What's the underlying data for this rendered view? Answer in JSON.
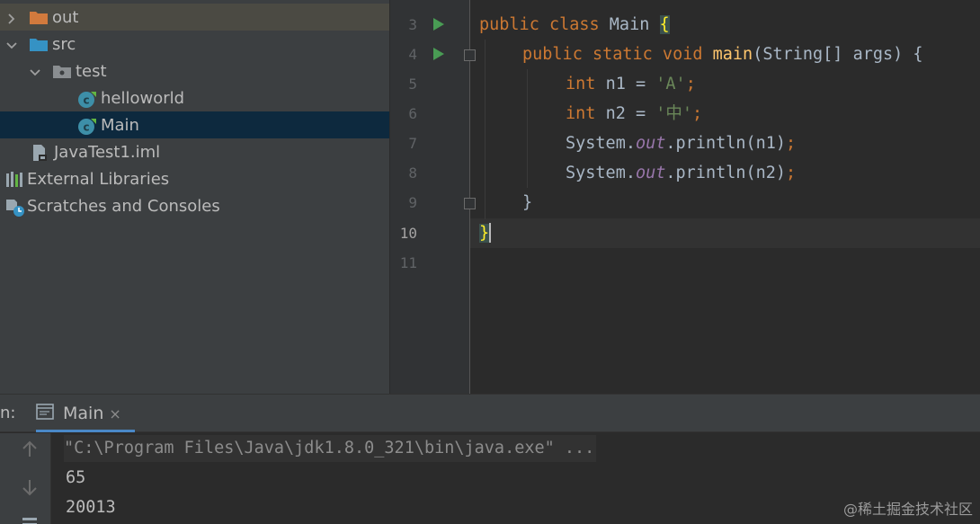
{
  "project_tree": {
    "items": [
      {
        "label": "out",
        "icon": "folder-orange-icon"
      },
      {
        "label": "src",
        "icon": "folder-blue-icon"
      },
      {
        "label": "test",
        "icon": "package-icon"
      },
      {
        "label": "helloworld",
        "icon": "java-class-icon"
      },
      {
        "label": "Main",
        "icon": "java-class-icon"
      },
      {
        "label": "JavaTest1.iml",
        "icon": "iml-file-icon"
      },
      {
        "label": "External Libraries",
        "icon": "libraries-icon"
      },
      {
        "label": "Scratches and Consoles",
        "icon": "scratches-icon"
      }
    ]
  },
  "editor": {
    "line_numbers": [
      "3",
      "4",
      "5",
      "6",
      "7",
      "8",
      "9",
      "10",
      "11"
    ],
    "active_line": "10",
    "code": {
      "l3": {
        "kw": "public class ",
        "name": "Main ",
        "brace": "{"
      },
      "l4": {
        "kw": "public static void ",
        "fn": "main",
        "rest": "(String[] args) {"
      },
      "l5": {
        "kw": "int ",
        "var": "n1 = ",
        "str": "'A'",
        "semi": ";"
      },
      "l6": {
        "kw": "int ",
        "var": "n2 = ",
        "str": "'中'",
        "semi": ";"
      },
      "l7": {
        "obj": "System.",
        "field": "out",
        "call": ".println(n1)",
        "semi": ";"
      },
      "l8": {
        "obj": "System.",
        "field": "out",
        "call": ".println(n2)",
        "semi": ";"
      },
      "l9": {
        "brace": "}"
      },
      "l10": {
        "brace": "}"
      }
    }
  },
  "run_panel": {
    "prefix": "n:",
    "tab_label": "Main",
    "tab_close": "×",
    "command": "\"C:\\Program Files\\Java\\jdk1.8.0_321\\bin\\java.exe\" ...",
    "output": [
      "65",
      "20013"
    ]
  },
  "watermark": "@稀土掘金技术社区",
  "colors": {
    "keyword": "#cc7832",
    "function": "#ffc66d",
    "string": "#6a8759",
    "static_field": "#9876aa",
    "selection": "#0d293e",
    "run_icon": "#499c54"
  }
}
